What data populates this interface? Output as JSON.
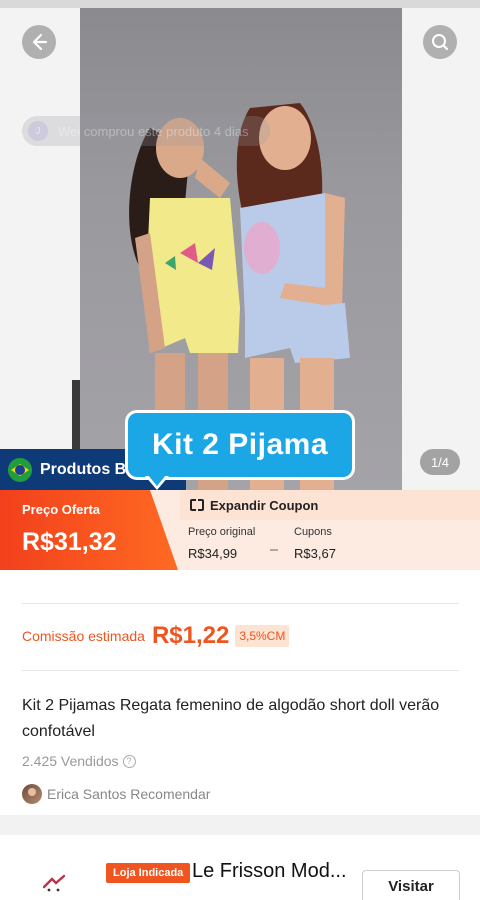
{
  "hero": {
    "toast_text": "Wei comprou este produto 4 dias",
    "toast_avatar_letter": "J",
    "image_counter": "1/4",
    "brand_label": "Produtos Brasil",
    "bubble_text": "Kit 2 Pijama",
    "icons": {
      "back": "back-arrow-icon",
      "search": "search-icon",
      "flag": "brazil-flag-icon"
    }
  },
  "price": {
    "offer_label": "Preço Oferta",
    "offer_value": "R$31,32",
    "expand_coupon": "Expandir Coupon",
    "original_label": "Preço original",
    "original_value": "R$34,99",
    "coupons_label": "Cupons",
    "coupons_value": "R$3,67"
  },
  "commission": {
    "label": "Comissão estimada",
    "value": "R$1,22",
    "badge": "3,5%CM"
  },
  "product": {
    "title": "Kit 2 Pijamas Regata femenino de algodão short doll verão confotável",
    "sold": "2.425 Vendidos",
    "recommender": "Erica Santos Recomendar"
  },
  "store": {
    "badge": "Loja Indicada",
    "name": "Le Frisson Mod...",
    "visit_button": "Visitar"
  },
  "colors": {
    "accent": "#f0541f",
    "brand_bar": "#0f3a78",
    "bubble": "#1ba6e6",
    "price_bg": "#fdebe1"
  }
}
